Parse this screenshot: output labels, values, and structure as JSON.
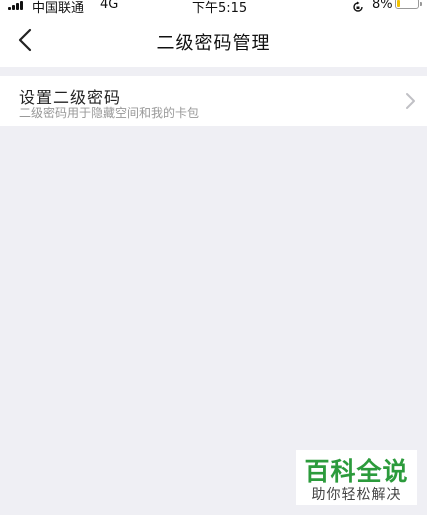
{
  "status_bar": {
    "carrier": "中国联通",
    "network": "4G",
    "time": "下午5:15",
    "battery_percent": "8%",
    "battery_level": 0.08
  },
  "nav": {
    "title": "二级密码管理",
    "back_icon": "chevron-left-icon"
  },
  "settings": {
    "items": [
      {
        "title": "设置二级密码",
        "subtitle": "二级密码用于隐藏空间和我的卡包",
        "icon": "chevron-right-icon"
      }
    ]
  },
  "watermark": {
    "main": "百科全说",
    "sub": "助你轻松解决"
  },
  "colors": {
    "background": "#efeff4",
    "surface": "#ffffff",
    "watermark_green": "#2c9b3c",
    "battery_low": "#f2c200"
  }
}
